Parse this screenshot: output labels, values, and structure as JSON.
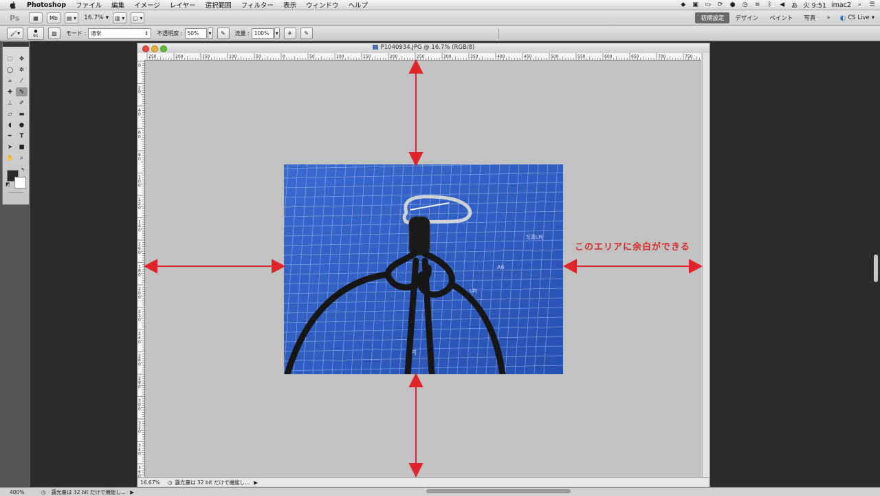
{
  "menubar": {
    "items": [
      "Photoshop",
      "ファイル",
      "編集",
      "イメージ",
      "レイヤー",
      "選択範囲",
      "フィルター",
      "表示",
      "ウィンドウ",
      "ヘルプ"
    ],
    "clock": "火 9:51",
    "user": "imac2",
    "input_method": "あ"
  },
  "appbar": {
    "logo": "Ps",
    "zoom": "16.7%",
    "workspaces": [
      "初期設定",
      "デザイン",
      "ペイント",
      "写真"
    ],
    "more": "»",
    "cslive": "CS Live"
  },
  "options": {
    "brush_size": "91",
    "mode_label": "モード :",
    "mode_value": "通常",
    "opacity_label": "不透明度 :",
    "opacity_value": "50%",
    "flow_label": "流量 :",
    "flow_value": "100%"
  },
  "document": {
    "title": "P1040934.JPG @ 16.7% (RGB/8)",
    "zoom": "16.67%",
    "status": "露光量は 32 bit だけで機能し..."
  },
  "ruler": {
    "h_labels": [
      "250",
      "200",
      "150",
      "100",
      "50",
      "0",
      "50",
      "100",
      "150",
      "200",
      "250",
      "300",
      "350",
      "400",
      "450",
      "500",
      "550",
      "600",
      "650",
      "700",
      "750"
    ],
    "v_labels": [
      "0",
      "20",
      "40",
      "60",
      "80",
      "100",
      "120",
      "140",
      "160",
      "180",
      "200",
      "220",
      "240",
      "260",
      "280",
      "300",
      "320",
      "340",
      "360"
    ]
  },
  "annotation": {
    "text": "このエリアに余白ができる",
    "color": "#d42a2a"
  },
  "app_status": {
    "zoom": "400%",
    "info": "露光量は 32 bit だけで機能し..."
  },
  "colors": {
    "arrow": "#e0242c",
    "canvas_bg": "#c2c2c2",
    "photo_bg": "#2f5cc0",
    "workspace_active": "#6a6a6a"
  }
}
